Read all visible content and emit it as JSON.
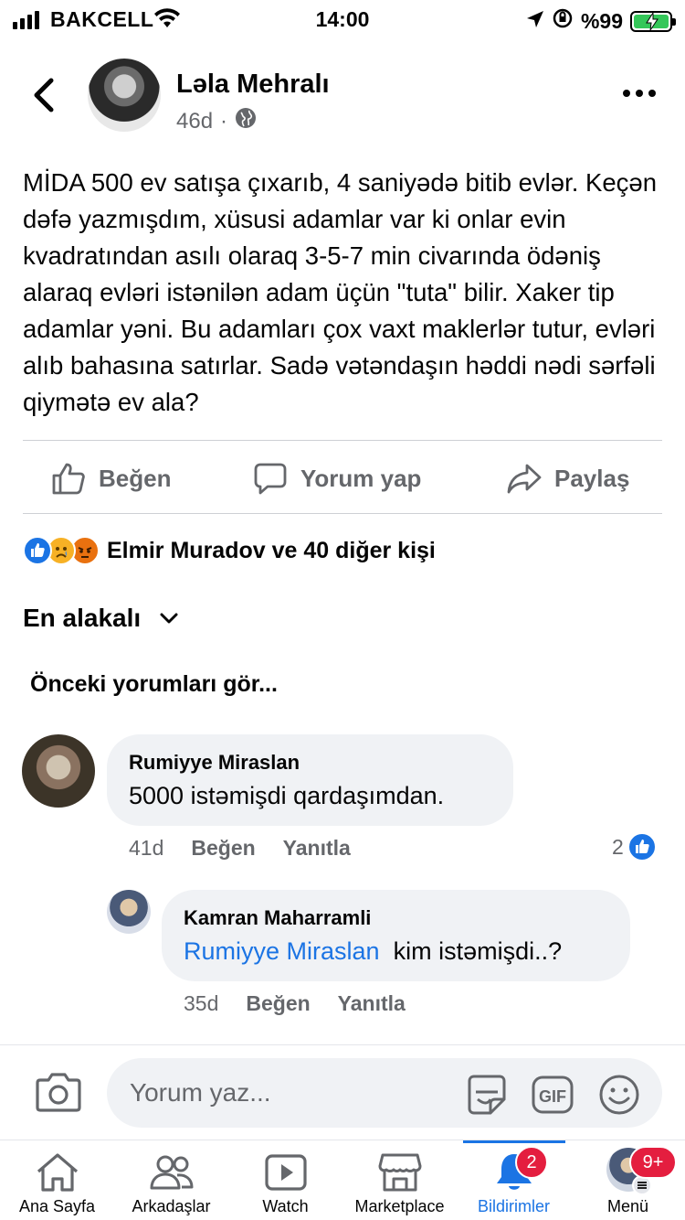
{
  "status_bar": {
    "carrier": "BAKCELL",
    "time": "14:00",
    "battery": "%99"
  },
  "post": {
    "author": "Ləla Mehralı",
    "time": "46d",
    "text": "MİDA 500 ev satışa çıxarıb, 4 saniyədə bitib evlər. Keçən dəfə yazmışdım, xüsusi adamlar var ki onlar evin kvadratından asılı olaraq 3-5-7 min civarında ödəniş alaraq evləri istənilən adam üçün \"tuta\" bilir. Xaker tip adamlar yəni. Bu adamları çox vaxt maklerlər tutur, evləri alıb bahasına satırlar. Sadə vətəndaşın həddi nədi sərfəli qiymətə ev ala?"
  },
  "actions": {
    "like": "Beğen",
    "comment": "Yorum yap",
    "share": "Paylaş"
  },
  "reactions": {
    "icons": [
      "like-icon",
      "sad-icon",
      "angry-icon"
    ],
    "summary": "Elmir Muradov ve 40 diğer kişi"
  },
  "sort": {
    "label": "En alakalı"
  },
  "prev_comments": "Önceki yorumları gör...",
  "comments": [
    {
      "author": "Rumiyye Miraslan",
      "text": "5000 istəmişdi qardaşımdan.",
      "time": "41d",
      "like": "Beğen",
      "reply": "Yanıtla",
      "like_count": "2"
    },
    {
      "author": "Kamran Maharramli",
      "mention": "Rumiyye Miraslan",
      "text": "kim istəmişdi..?",
      "time": "35d",
      "like": "Beğen",
      "reply": "Yanıtla"
    }
  ],
  "composer": {
    "placeholder": "Yorum yaz...",
    "gif": "GIF"
  },
  "tabs": [
    {
      "label": "Ana Sayfa",
      "icon": "home-icon"
    },
    {
      "label": "Arkadaşlar",
      "icon": "friends-icon"
    },
    {
      "label": "Watch",
      "icon": "watch-icon"
    },
    {
      "label": "Marketplace",
      "icon": "marketplace-icon"
    },
    {
      "label": "Bildirimler",
      "icon": "bell-icon",
      "badge": "2",
      "active": true
    },
    {
      "label": "Menü",
      "icon": "menu-icon",
      "badge": "9+"
    }
  ],
  "colors": {
    "accent": "#1b74e4",
    "badge": "#e41e3f",
    "secondary_text": "#65676b",
    "bubble": "#f0f2f5"
  }
}
